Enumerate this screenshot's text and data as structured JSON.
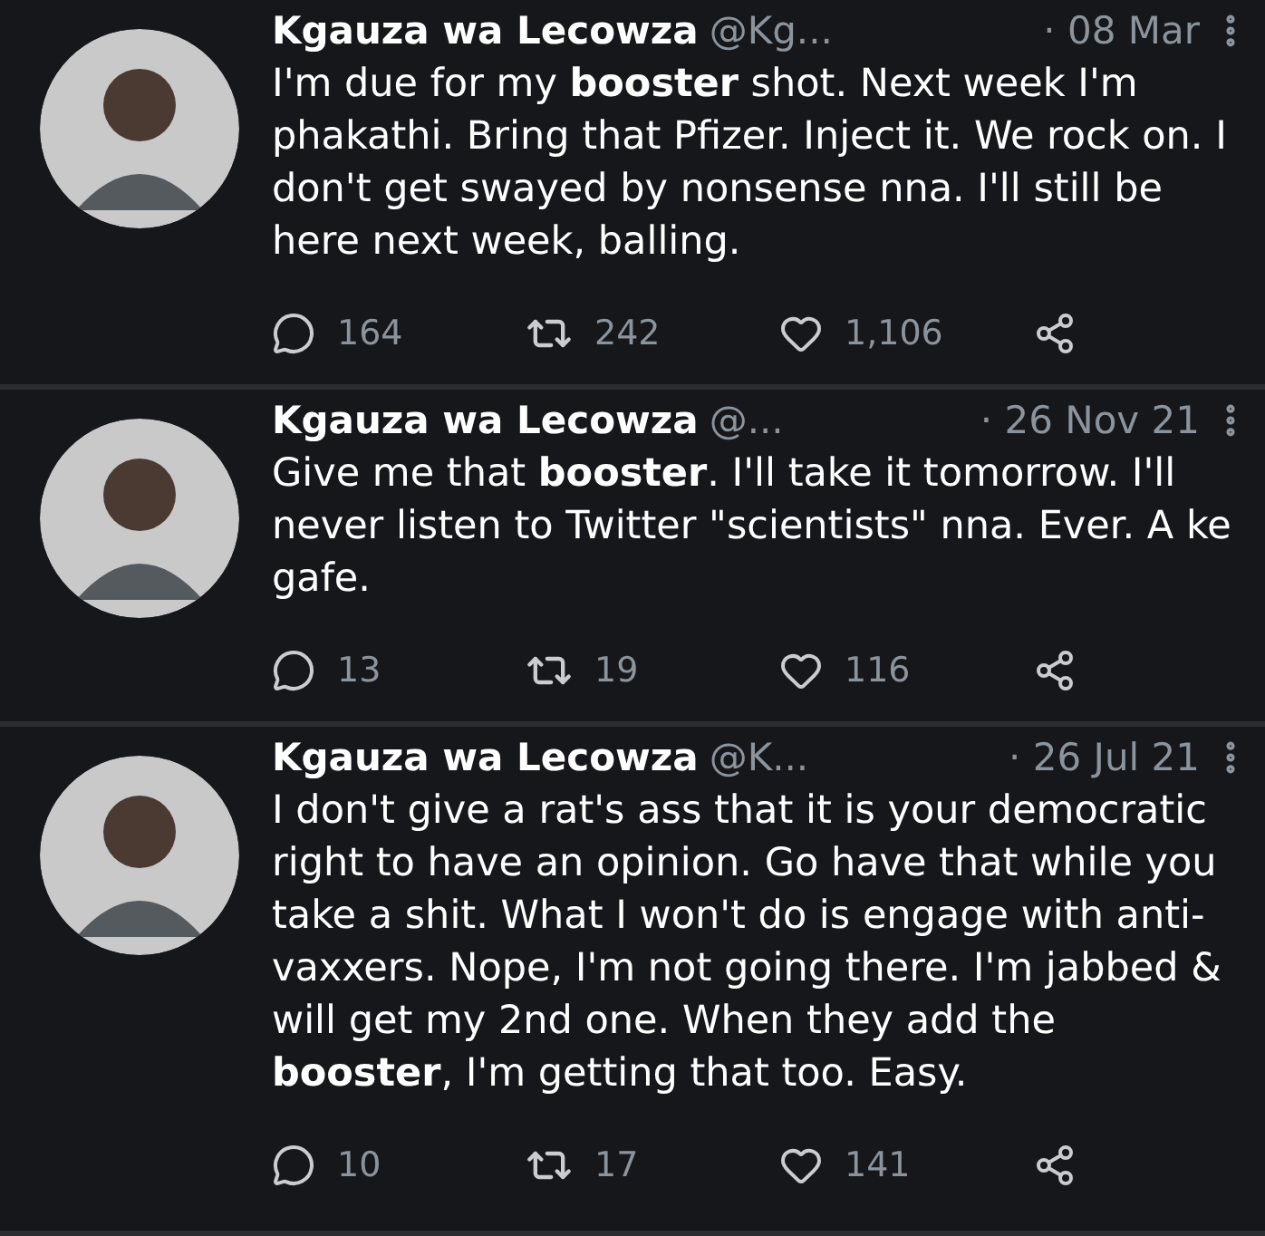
{
  "tweets": [
    {
      "name": "Kgauza wa Lecowza",
      "handle": "@Kg...",
      "date": "· 08 Mar",
      "text": "I'm due for my **booster** shot. Next week I'm phakathi. Bring that Pfizer. Inject it. We rock on. I don't get swayed by nonsense nna. I'll still be here next week, balling.",
      "replies": "164",
      "retweets": "242",
      "likes": "1,106"
    },
    {
      "name": "Kgauza wa Lecowza",
      "handle": "@...",
      "date": "· 26 Nov 21",
      "text": "Give me that **booster**. I'll take it tomorrow. I'll never listen to Twitter \"scientists\" nna. Ever. A ke gafe.",
      "replies": "13",
      "retweets": "19",
      "likes": "116"
    },
    {
      "name": "Kgauza wa Lecowza",
      "handle": "@K...",
      "date": "· 26 Jul 21",
      "text": "I don't give a rat's ass that it is your democratic right to have an opinion. Go have that while you take a shit. What I won't do is engage with anti-vaxxers. Nope, I'm not going there. I'm jabbed & will get my 2nd one. When they add the **booster**, I'm getting that too. Easy.",
      "replies": "10",
      "retweets": "17",
      "likes": "141"
    }
  ]
}
